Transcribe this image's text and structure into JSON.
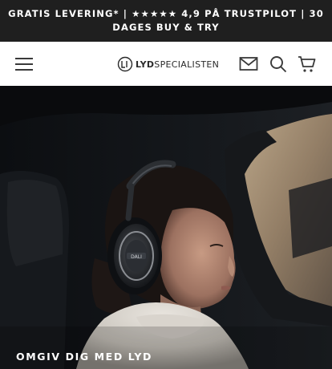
{
  "announcement": {
    "text": "GRATIS LEVERING* | ★★★★★ 4,9 PÅ TRUSTPILOT | 30 DAGES BUY & TRY"
  },
  "header": {
    "logo": {
      "prefix": "LYD",
      "suffix": "SPECIALISTEN"
    },
    "icons": [
      "menu-icon",
      "mail-icon",
      "search-icon",
      "cart-icon"
    ]
  },
  "hero": {
    "caption": "OMGIV DIG MED LYD",
    "headphone_brand": "DALI"
  },
  "colors": {
    "announcement_bg": "#1f1f1f",
    "header_bg": "#ffffff",
    "icon_color": "#3a3a3a"
  }
}
